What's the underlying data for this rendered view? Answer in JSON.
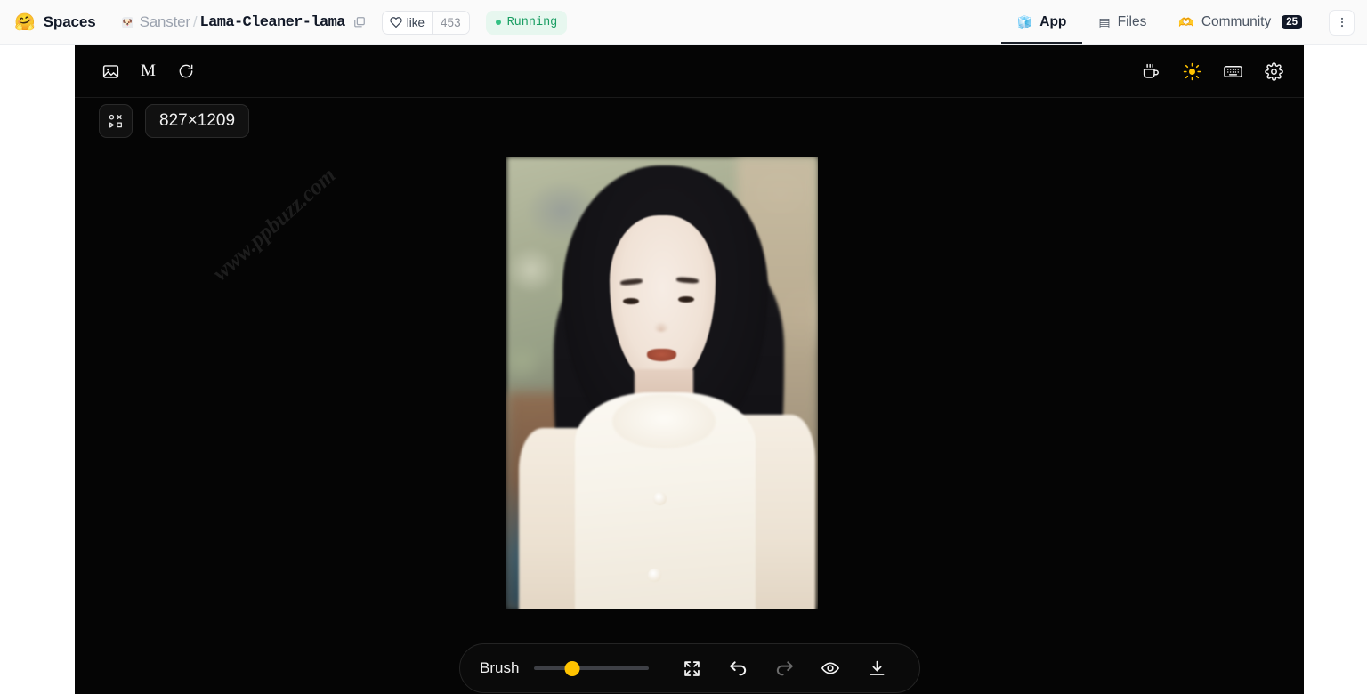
{
  "header": {
    "logo_emoji": "🤗",
    "brand": "Spaces",
    "owner_avatar_emoji": "🐶",
    "owner": "Sanster",
    "separator": "/",
    "repo": "Lama-Cleaner-lama",
    "copy_icon": "copy-icon",
    "like_label": "like",
    "like_count": "453",
    "status": "Running",
    "status_color": "#1a9e63",
    "tabs": [
      {
        "emoji": "🧊",
        "label": "App",
        "active": true
      },
      {
        "emoji": "▤",
        "label": "Files",
        "active": false
      },
      {
        "emoji": "🫶",
        "label": "Community",
        "badge": "25",
        "active": false
      }
    ],
    "kebab_icon": "more-vertical-icon"
  },
  "app": {
    "toolbar_left": [
      {
        "name": "image-icon",
        "label": ""
      },
      {
        "name": "model-m-label",
        "label": "M"
      },
      {
        "name": "refresh-icon",
        "label": ""
      }
    ],
    "toolbar_right": [
      {
        "name": "coffee-icon"
      },
      {
        "name": "sun-icon",
        "color": "#ffc300"
      },
      {
        "name": "keyboard-icon"
      },
      {
        "name": "gear-icon"
      }
    ],
    "shapes_button_icon": "shapes-grid-icon",
    "dimensions": "827×1209",
    "watermark": "www.ppbuzz.com",
    "image_alt": "portrait-photo-woman-white-scarf"
  },
  "bottom_toolbar": {
    "brush_label": "Brush",
    "brush_value": 33,
    "brush_thumb_color": "#ffc300",
    "actions": [
      {
        "name": "fullscreen-icon",
        "enabled": true
      },
      {
        "name": "undo-icon",
        "enabled": true
      },
      {
        "name": "redo-icon",
        "enabled": false
      },
      {
        "name": "eye-icon",
        "enabled": true
      },
      {
        "name": "download-icon",
        "enabled": true
      }
    ]
  }
}
